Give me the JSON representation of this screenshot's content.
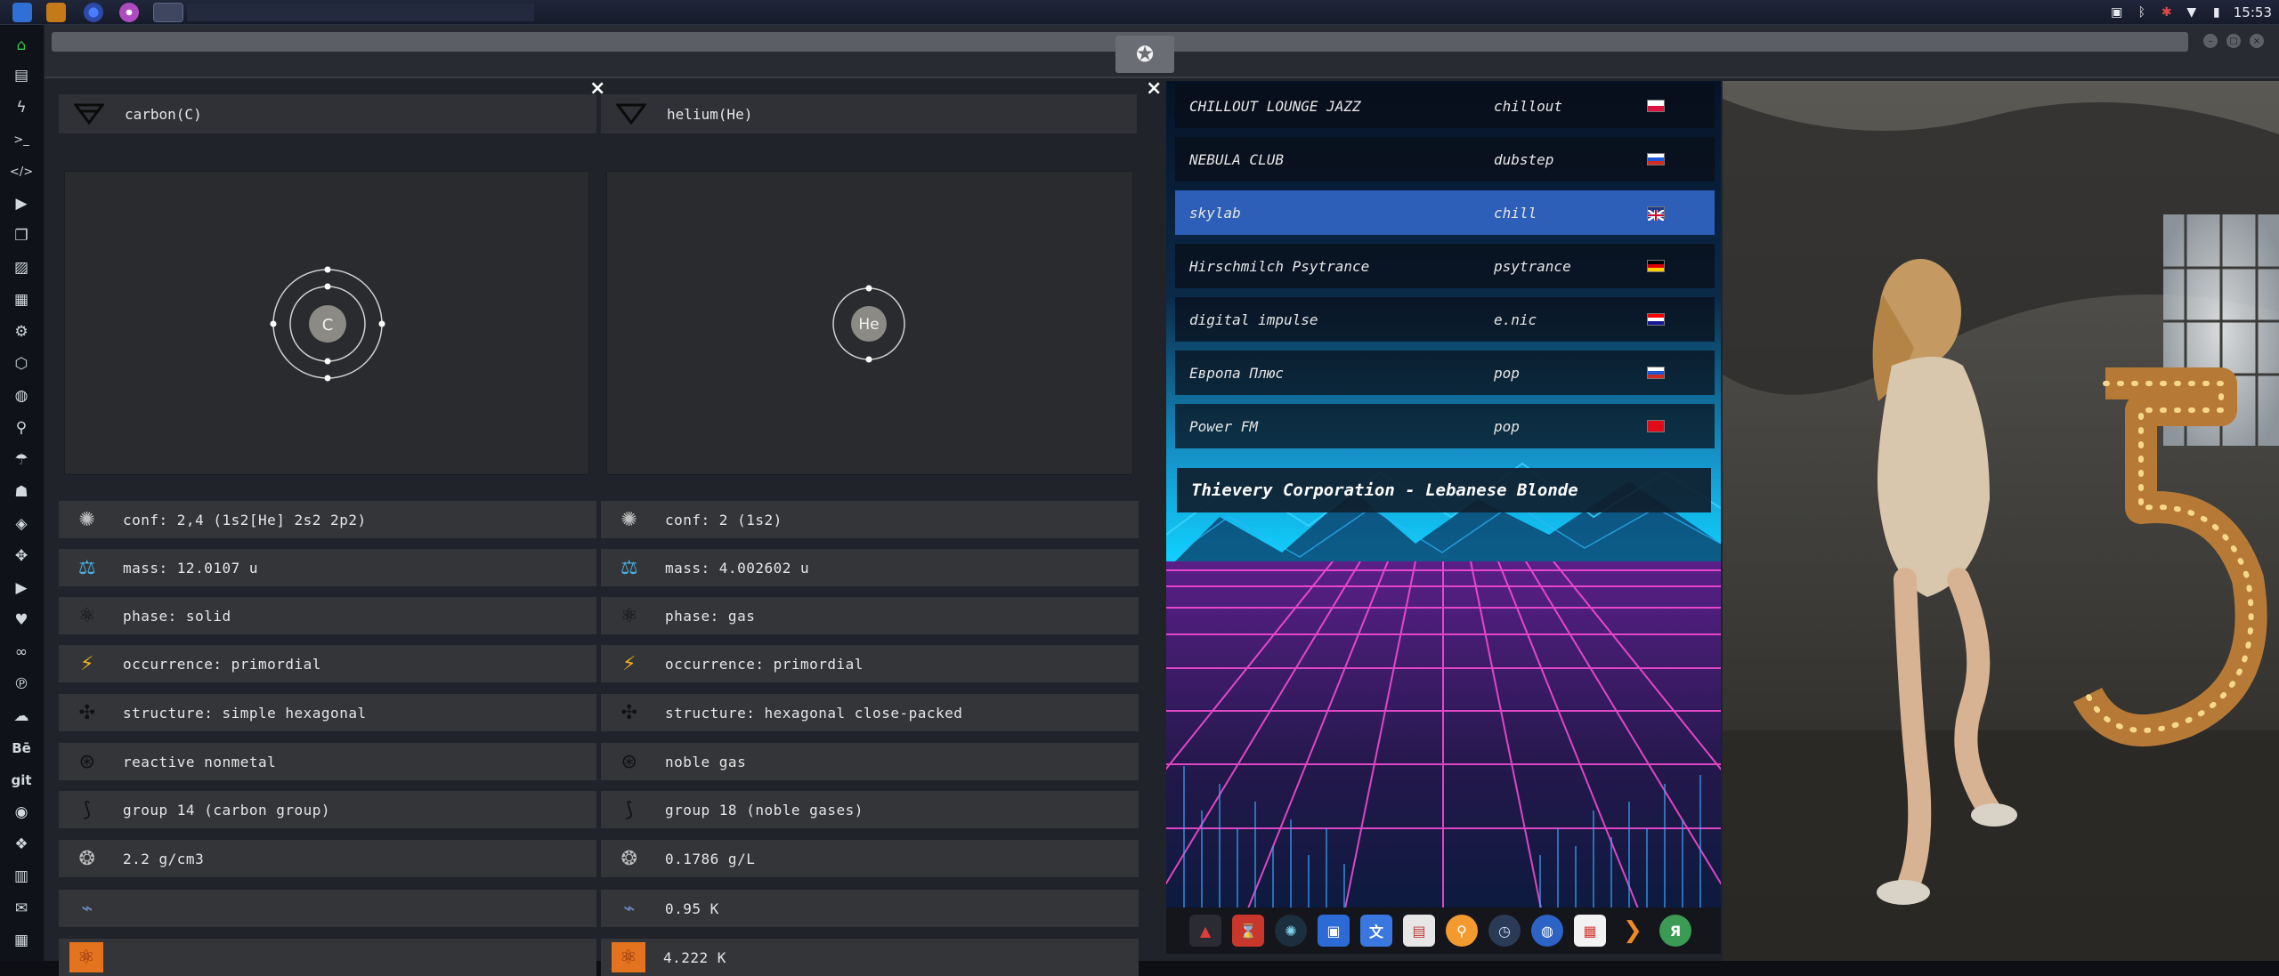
{
  "topbar": {
    "clock": "15:53"
  },
  "colors": {
    "accent_blue": "#2d5fb8",
    "panel_bg": "#333539",
    "window_bg": "#202329"
  },
  "left_dock": {
    "icons": [
      "home-icon",
      "document-icon",
      "bolt-icon",
      "terminal-icon",
      "code-icon",
      "play-icon",
      "copy-icon",
      "image-icon",
      "news-icon",
      "settings-icon",
      "hexagon-icon",
      "globe-icon",
      "search-icon",
      "umbrella-icon",
      "contacts-icon",
      "tag-icon",
      "puzzle-icon",
      "youtube-icon",
      "heart-icon",
      "infinity-icon",
      "pinterest-icon",
      "cloud-icon",
      "behance-icon",
      "git-icon",
      "github-icon",
      "cube-icon",
      "map-icon",
      "mail-icon",
      "calendar-icon"
    ],
    "text_items": {
      "behance": "Bē",
      "git": "git"
    }
  },
  "elements": [
    {
      "name": "carbon(C)",
      "symbol": "C",
      "props": [
        "conf: 2,4 (1s2[He] 2s2 2p2)",
        "mass: 12.0107 u",
        "phase: solid",
        "occurrence: primordial",
        "structure: simple hexagonal",
        "reactive nonmetal",
        "group 14 (carbon group)",
        "2.2 g/cm3",
        "",
        ""
      ]
    },
    {
      "name": "helium(He)",
      "symbol": "He",
      "props": [
        "conf: 2 (1s2)",
        "mass: 4.002602 u",
        "phase: gas",
        "occurrence: primordial",
        "structure: hexagonal close-packed",
        "noble gas",
        "group 18 (noble gases)",
        "0.1786 g/L",
        "0.95 K",
        "4.222 K"
      ]
    }
  ],
  "close_label": "×",
  "radio": {
    "stations": [
      {
        "name": "CHILLOUT LOUNGE JAZZ",
        "genre": "chillout",
        "flag": "poland"
      },
      {
        "name": "NEBULA CLUB",
        "genre": "dubstep",
        "flag": "russia"
      },
      {
        "name": "skylab",
        "genre": "chill",
        "flag": "uk"
      },
      {
        "name": "Hirschmilch Psytrance",
        "genre": "psytrance",
        "flag": "germany"
      },
      {
        "name": "digital impulse",
        "genre": "e.nic",
        "flag": "croatia"
      },
      {
        "name": "Европа Плюс",
        "genre": "pop",
        "flag": "russia"
      },
      {
        "name": "Power FM",
        "genre": "pop",
        "flag": "turkey"
      }
    ],
    "now_playing": "Thievery Corporation - Lebanese Blonde"
  },
  "bottom_dock": {
    "icons": [
      "vectorize-icon",
      "hourglass-icon",
      "galaxy-icon",
      "image-viewer-icon",
      "translate-icon",
      "screenshot-icon",
      "search-icon",
      "clock-icon",
      "browser-icon",
      "calendar-icon",
      "arrow-icon",
      "yandex-icon"
    ],
    "yandex_label": "Я"
  }
}
